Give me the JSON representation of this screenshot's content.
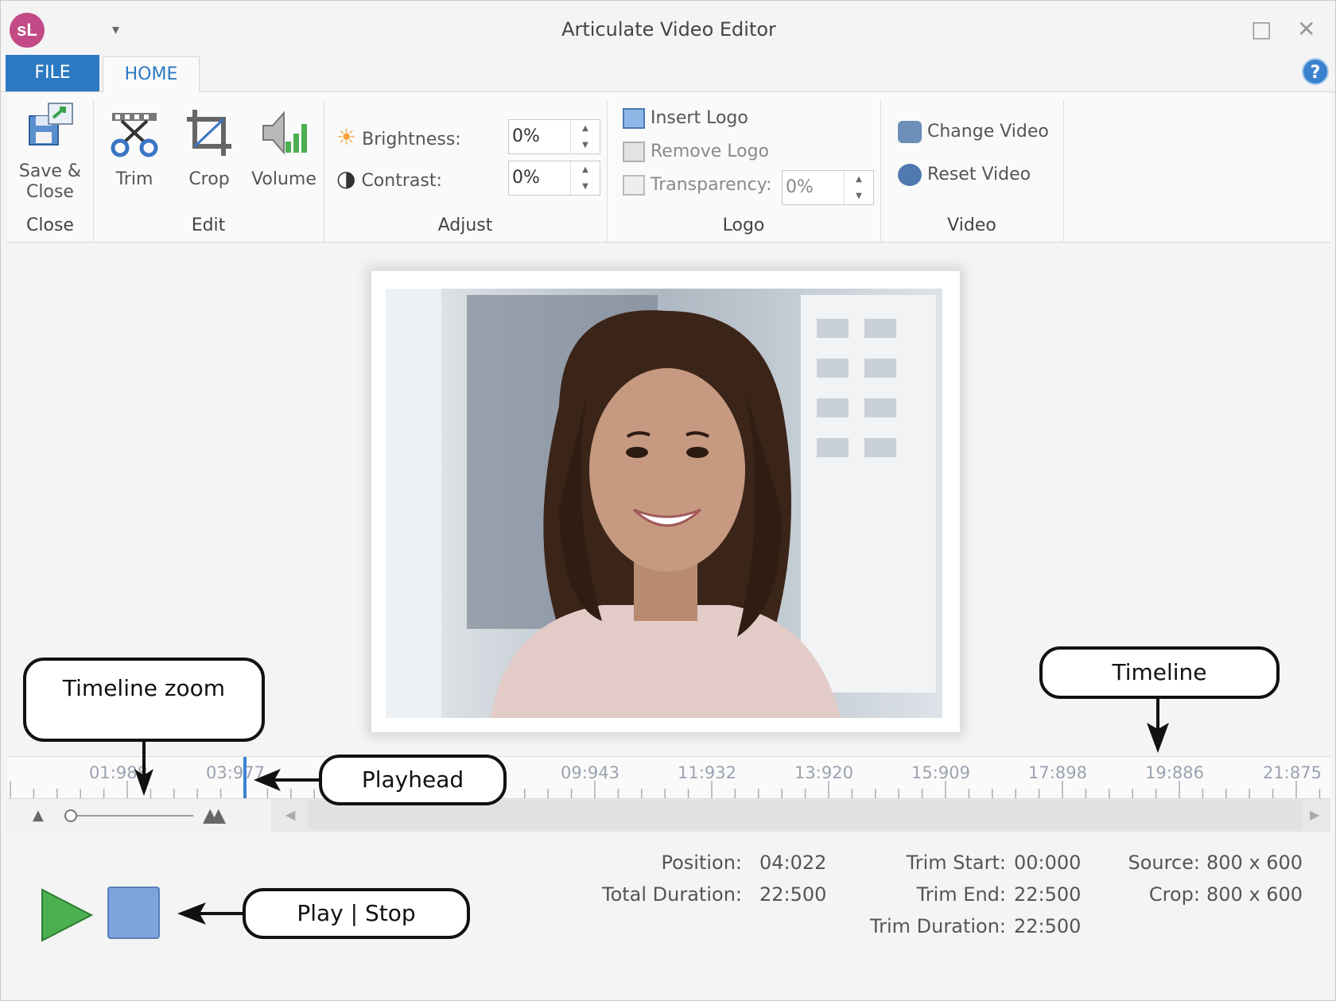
{
  "window": {
    "title": "Articulate Video Editor",
    "logo_text": "sL"
  },
  "tabs": {
    "file": "FILE",
    "home": "HOME",
    "help": "?"
  },
  "ribbon": {
    "close_group": {
      "label": "Close",
      "save_close_line1": "Save &",
      "save_close_line2": "Close"
    },
    "edit_group": {
      "label": "Edit",
      "trim": "Trim",
      "crop": "Crop",
      "volume": "Volume"
    },
    "adjust_group": {
      "label": "Adjust",
      "brightness_label": "Brightness:",
      "brightness_value": "0%",
      "contrast_label": "Contrast:",
      "contrast_value": "0%"
    },
    "logo_group": {
      "label": "Logo",
      "insert_logo": "Insert Logo",
      "remove_logo": "Remove Logo",
      "transparency_label": "Transparency:",
      "transparency_value": "0%"
    },
    "video_group": {
      "label": "Video",
      "change_video": "Change Video",
      "reset_video": "Reset Video"
    }
  },
  "timeline": {
    "tick_labels": [
      "01:988",
      "03:977",
      "09:943",
      "11:932",
      "13:920",
      "15:909",
      "17:898",
      "19:886",
      "21:875"
    ]
  },
  "status": {
    "position_label": "Position:",
    "position_value": "04:022",
    "total_duration_label": "Total Duration:",
    "total_duration_value": "22:500",
    "trim_start_label": "Trim Start:",
    "trim_start_value": "00:000",
    "trim_end_label": "Trim End:",
    "trim_end_value": "22:500",
    "trim_duration_label": "Trim Duration:",
    "trim_duration_value": "22:500",
    "source_label": "Source:",
    "source_value": "800 x 600",
    "crop_label": "Crop:",
    "crop_value": "800 x 600"
  },
  "callouts": {
    "timeline_zoom": "Timeline zoom",
    "timeline": "Timeline",
    "playhead": "Playhead",
    "play_stop": "Play | Stop"
  },
  "colors": {
    "accent": "#2b79c2",
    "play": "#4caf50",
    "stop": "#7fa3dc",
    "logo": "#c34a86"
  }
}
